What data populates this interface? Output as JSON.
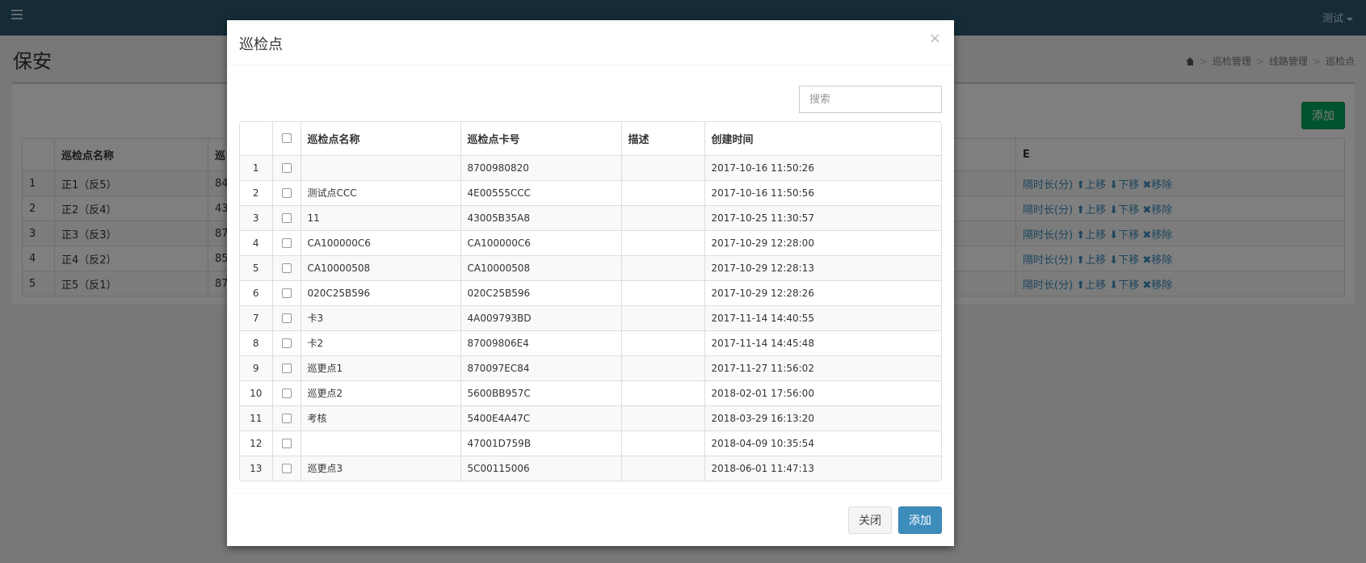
{
  "navbar": {
    "user": "测试"
  },
  "page": {
    "title": "保安",
    "breadcrumb": [
      "巡检管理",
      "线路管理",
      "巡检点"
    ],
    "add_label": "添加",
    "headers": [
      "巡检点名称",
      "巡",
      "E"
    ],
    "rows": [
      {
        "idx": "1",
        "name": "正1（反5）",
        "card": "84"
      },
      {
        "idx": "2",
        "name": "正2（反4）",
        "card": "43"
      },
      {
        "idx": "3",
        "name": "正3（反3）",
        "card": "87"
      },
      {
        "idx": "4",
        "name": "正4（反2）",
        "card": "85"
      },
      {
        "idx": "5",
        "name": "正5（反1）",
        "card": "87"
      }
    ],
    "row_actions": "隔时长(分) ⬆上移 ⬇下移 ✖移除"
  },
  "modal": {
    "title": "巡检点",
    "close_glyph": "×",
    "search_placeholder": "搜索",
    "columns": [
      "巡检点名称",
      "巡检点卡号",
      "描述",
      "创建时间"
    ],
    "rows": [
      {
        "idx": "1",
        "name": "",
        "card": "8700980820",
        "desc": "",
        "created": "2017-10-16 11:50:26"
      },
      {
        "idx": "2",
        "name": "测试点CCC",
        "card": "4E00555CCC",
        "desc": "",
        "created": "2017-10-16 11:50:56"
      },
      {
        "idx": "3",
        "name": "11",
        "card": "43005B35A8",
        "desc": "",
        "created": "2017-10-25 11:30:57"
      },
      {
        "idx": "4",
        "name": "CA100000C6",
        "card": "CA100000C6",
        "desc": "",
        "created": "2017-10-29 12:28:00"
      },
      {
        "idx": "5",
        "name": "CA10000508",
        "card": "CA10000508",
        "desc": "",
        "created": "2017-10-29 12:28:13"
      },
      {
        "idx": "6",
        "name": "020C25B596",
        "card": "020C25B596",
        "desc": "",
        "created": "2017-10-29 12:28:26"
      },
      {
        "idx": "7",
        "name": "卡3",
        "card": "4A009793BD",
        "desc": "",
        "created": "2017-11-14 14:40:55"
      },
      {
        "idx": "8",
        "name": "卡2",
        "card": "87009806E4",
        "desc": "",
        "created": "2017-11-14 14:45:48"
      },
      {
        "idx": "9",
        "name": "巡更点1",
        "card": "870097EC84",
        "desc": "",
        "created": "2017-11-27 11:56:02"
      },
      {
        "idx": "10",
        "name": "巡更点2",
        "card": "5600BB957C",
        "desc": "",
        "created": "2018-02-01 17:56:00"
      },
      {
        "idx": "11",
        "name": "考核",
        "card": "5400E4A47C",
        "desc": "",
        "created": "2018-03-29 16:13:20"
      },
      {
        "idx": "12",
        "name": "",
        "card": "47001D759B",
        "desc": "",
        "created": "2018-04-09 10:35:54"
      },
      {
        "idx": "13",
        "name": "巡更点3",
        "card": "5C00115006",
        "desc": "",
        "created": "2018-06-01 11:47:13"
      }
    ],
    "close_label": "关闭",
    "add_label": "添加"
  },
  "colors": {
    "navbar": "#2b5870",
    "primary": "#3c8dbc",
    "success": "#00a65a"
  }
}
